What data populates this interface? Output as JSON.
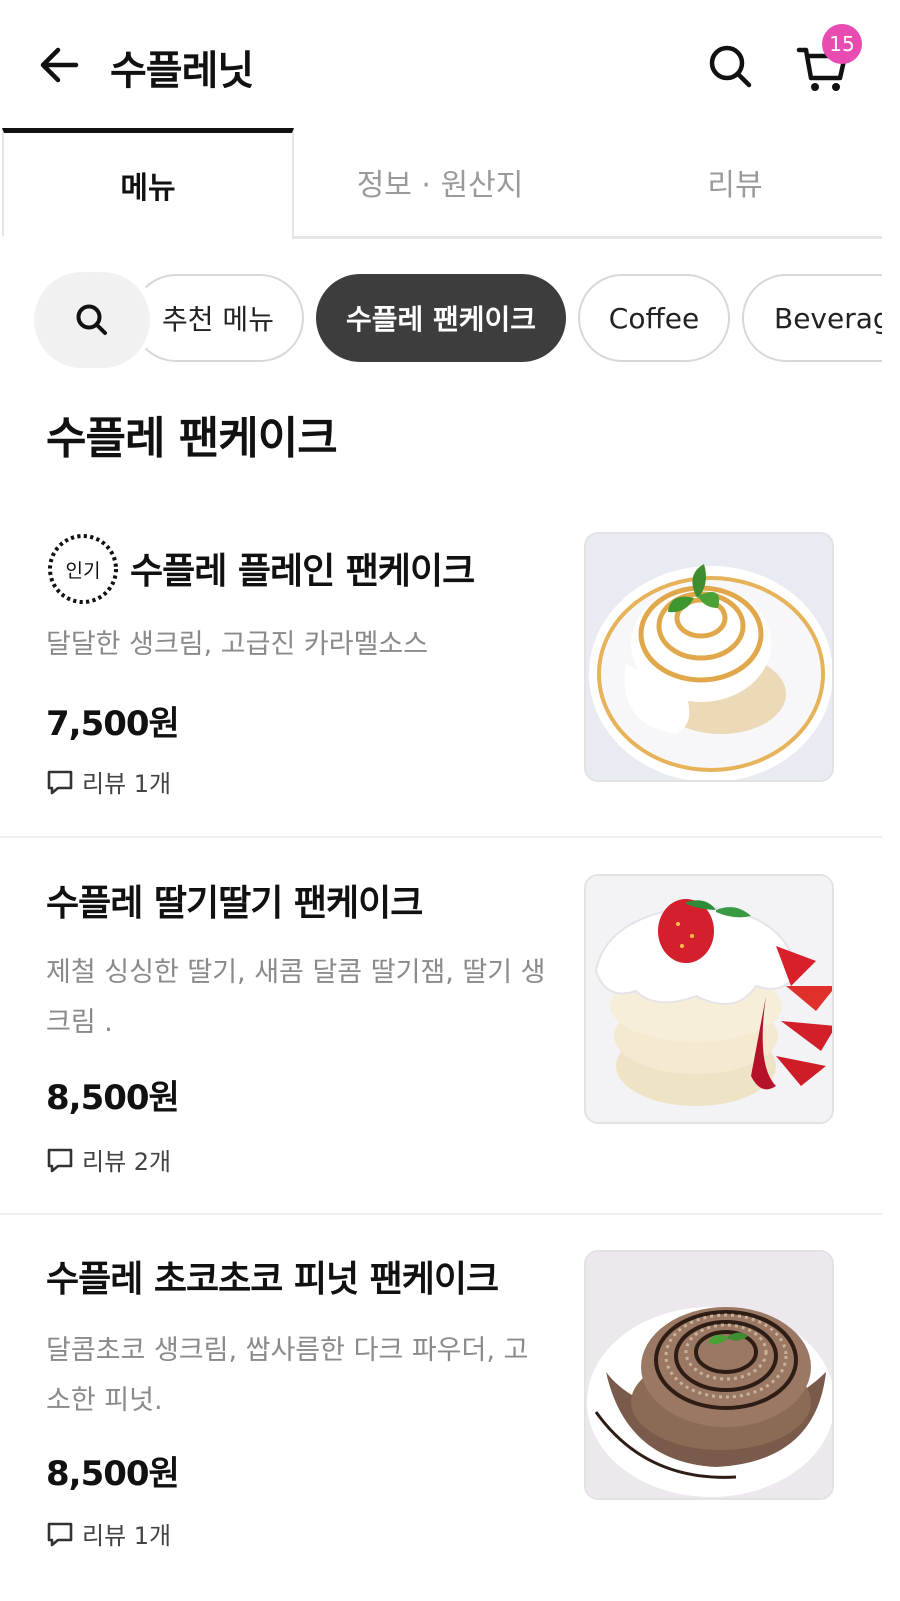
{
  "header": {
    "title": "수플레닛",
    "cart_count": "15"
  },
  "tabs": [
    {
      "label": "메뉴"
    },
    {
      "label": "정보 · 원산지"
    },
    {
      "label": "리뷰"
    }
  ],
  "chips": [
    {
      "label": "추천 메뉴"
    },
    {
      "label": "수플레 팬케이크"
    },
    {
      "label": "Coffee"
    },
    {
      "label": "Beverage"
    }
  ],
  "section": {
    "title": "수플레 팬케이크"
  },
  "items": [
    {
      "badge": "인기",
      "name": "수플레 플레인 팬케이크",
      "description": "달달한 생크림, 고급진 카라멜소스",
      "price": "7,500원",
      "review": "리뷰 1개"
    },
    {
      "name": "수플레 딸기딸기 팬케이크",
      "description": "제철 싱싱한 딸기, 새콤 달콤 딸기잼, 딸기 생크림 .",
      "price": "8,500원",
      "review": "리뷰 2개"
    },
    {
      "name": "수플레 초코초코 피넛 팬케이크",
      "description": "달콤초코 생크림, 쌉사름한 다크 파우더, 고소한 피넛.",
      "price": "8,500원",
      "review": "리뷰 1개"
    }
  ],
  "colors": {
    "badge": "#e84cb0",
    "active_chip": "#3d3d3d"
  }
}
